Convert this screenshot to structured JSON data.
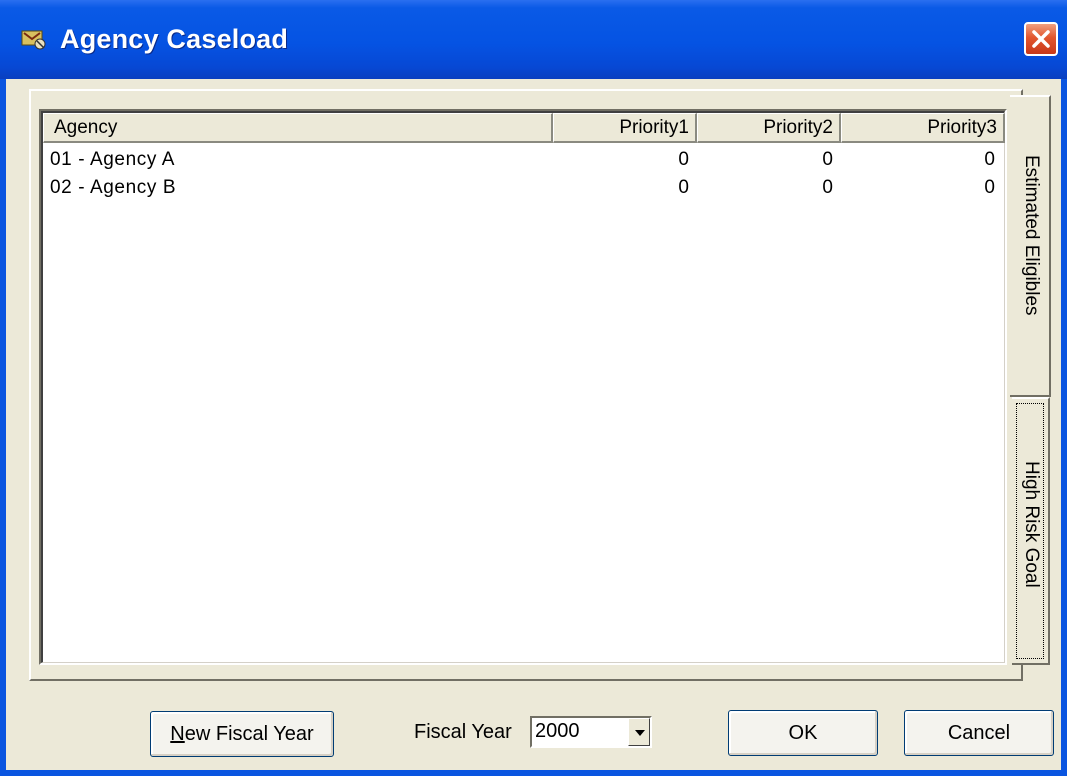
{
  "window": {
    "title": "Agency Caseload",
    "close_icon": "close-icon",
    "app_icon": "app-icon"
  },
  "colors": {
    "titlebar": "#0553e3",
    "client": "#ece9d8",
    "close": "#e2562e"
  },
  "table": {
    "columns": [
      "Agency",
      "Priority1",
      "Priority2",
      "Priority3"
    ],
    "rows": [
      {
        "agency": "01 - Agency A",
        "p1": "0",
        "p2": "0",
        "p3": "0"
      },
      {
        "agency": "02 - Agency B",
        "p1": "0",
        "p2": "0",
        "p3": "0"
      }
    ]
  },
  "tabs": [
    {
      "label": "Estimated Eligibles",
      "selected": true
    },
    {
      "label": "High Risk Goal",
      "selected": false
    }
  ],
  "footer": {
    "new_fiscal_year_prefix": "N",
    "new_fiscal_year_rest": "ew Fiscal Year",
    "fiscal_year_label": "Fiscal Year",
    "fiscal_year_value": "2000",
    "ok_label": "OK",
    "cancel_label": "Cancel"
  }
}
